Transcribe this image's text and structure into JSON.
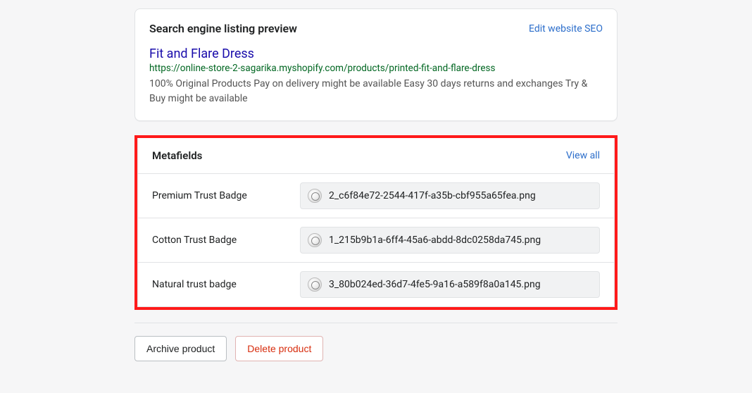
{
  "seo_card": {
    "heading": "Search engine listing preview",
    "edit_link": "Edit website SEO",
    "title": "Fit and Flare Dress",
    "url": "https://online-store-2-sagarika.myshopify.com/products/printed-fit-and-flare-dress",
    "description": "100% Original Products Pay on delivery might be available Easy 30 days returns and exchanges Try & Buy might be available"
  },
  "metafields": {
    "heading": "Metafields",
    "view_all": "View all",
    "rows": [
      {
        "label": "Premium Trust Badge",
        "filename": "2_c6f84e72-2544-417f-a35b-cbf955a65fea.png"
      },
      {
        "label": "Cotton Trust Badge",
        "filename": "1_215b9b1a-6ff4-45a6-abdd-8dc0258da745.png"
      },
      {
        "label": "Natural trust badge",
        "filename": "3_80b024ed-36d7-4fe5-9a16-a589f8a0a145.png"
      }
    ]
  },
  "actions": {
    "archive": "Archive product",
    "delete": "Delete product"
  }
}
